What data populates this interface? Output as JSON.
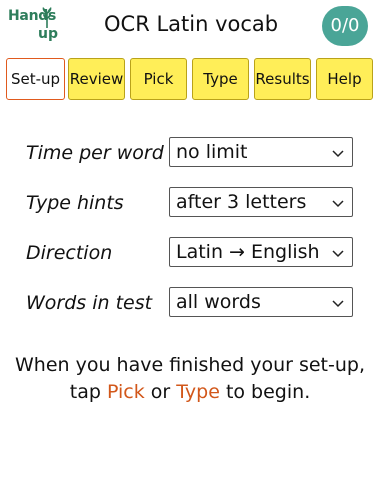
{
  "app": {
    "logo_top": "Hands",
    "logo_bottom": "up",
    "title": "OCR Latin vocab",
    "score": "0/0"
  },
  "tabs": [
    {
      "label": "Set-up",
      "active": true
    },
    {
      "label": "Review",
      "active": false
    },
    {
      "label": "Pick",
      "active": false
    },
    {
      "label": "Type",
      "active": false
    },
    {
      "label": "Results",
      "active": false
    },
    {
      "label": "Help",
      "active": false
    }
  ],
  "settings": [
    {
      "label": "Time per word",
      "value": "no limit"
    },
    {
      "label": "Type hints",
      "value": "after 3 letters"
    },
    {
      "label": "Direction",
      "value": "Latin → English"
    },
    {
      "label": "Words in test",
      "value": "all words"
    }
  ],
  "instruction": {
    "line1": "When you have finished your set-up,",
    "pre": "tap ",
    "pick": "Pick",
    "mid": " or ",
    "type": "Type",
    "post": " to begin."
  },
  "colors": {
    "score_bg": "#4aa597",
    "tab_bg": "#ffee58",
    "active_tab_border": "#e05a1e",
    "accent": "#d2571a",
    "logo": "#2e7d5b"
  },
  "icons": {
    "logo": "hand-raised-plant-icon",
    "select": "chevron-down-icon"
  }
}
